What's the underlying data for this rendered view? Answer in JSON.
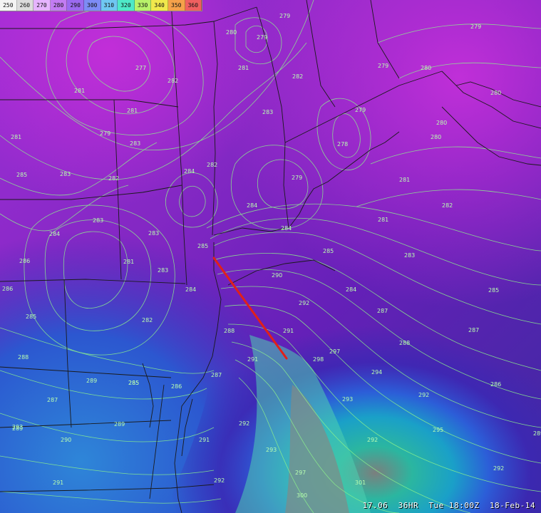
{
  "legend": {
    "items": [
      {
        "label": "250",
        "color": "#f4f4f4"
      },
      {
        "label": "260",
        "color": "#dcdcdc"
      },
      {
        "label": "270",
        "color": "#e6b4ff"
      },
      {
        "label": "280",
        "color": "#c27cf2"
      },
      {
        "label": "290",
        "color": "#9b6af0"
      },
      {
        "label": "300",
        "color": "#7d8cf5"
      },
      {
        "label": "310",
        "color": "#6fc7f2"
      },
      {
        "label": "320",
        "color": "#4ee9c8"
      },
      {
        "label": "330",
        "color": "#b8f26a"
      },
      {
        "label": "340",
        "color": "#f0e84c"
      },
      {
        "label": "350",
        "color": "#f5a24a"
      },
      {
        "label": "360",
        "color": "#f06060"
      }
    ]
  },
  "status": {
    "version": "17.06",
    "forecast": "36HR",
    "valid": "Tue 18:00Z",
    "date": "18-Feb-14"
  },
  "colors": {
    "contour": "#8cf28c",
    "border": "#1a1a1a",
    "cross_section": "#e0201a"
  },
  "contour_labels": [
    "279",
    "280",
    "279",
    "281",
    "279",
    "279",
    "277",
    "281",
    "282",
    "280",
    "279",
    "281",
    "279",
    "283",
    "280",
    "281",
    "280",
    "278",
    "282",
    "284",
    "280",
    "279",
    "282",
    "281",
    "283",
    "285",
    "283",
    "282",
    "284",
    "281",
    "283",
    "282",
    "283",
    "283",
    "284",
    "284",
    "286",
    "281",
    "285",
    "283",
    "285",
    "284",
    "286",
    "285",
    "285",
    "287",
    "282",
    "284",
    "290",
    "292",
    "287",
    "288",
    "287",
    "285",
    "286",
    "288",
    "291",
    "289",
    "291",
    "287",
    "290",
    "292",
    "293",
    "297",
    "294",
    "298",
    "292",
    "293",
    "295",
    "292",
    "289",
    "292",
    "291",
    "293",
    "297",
    "301",
    "300",
    "285",
    "288",
    "286",
    "289",
    "289",
    "291",
    "292"
  ]
}
